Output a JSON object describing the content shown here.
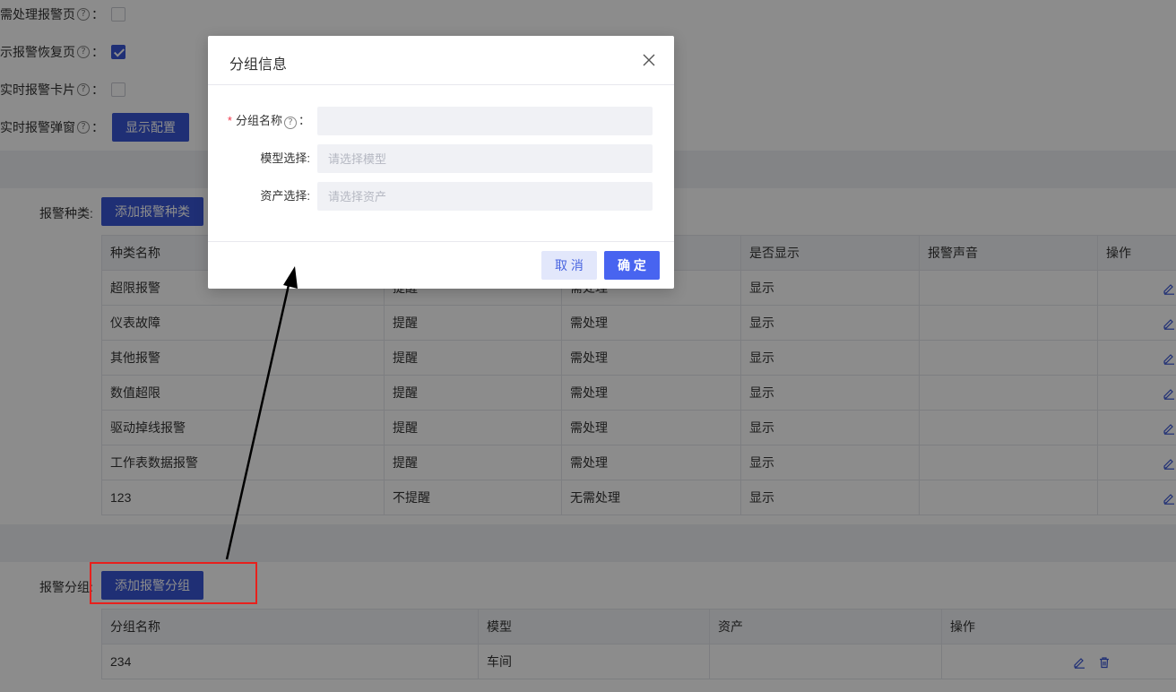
{
  "settings": [
    {
      "label": "需处理报警页",
      "checked": false
    },
    {
      "label": "示报警恢复页",
      "checked": true
    },
    {
      "label": "实时报警卡片",
      "checked": false
    },
    {
      "label": "实时报警弹窗",
      "button": "显示配置"
    }
  ],
  "help_glyph": "?",
  "colon": "：",
  "alarm_types": {
    "label": "报警种类:",
    "add_button": "添加报警种类",
    "columns": [
      "种类名称",
      "",
      "",
      "是否显示",
      "报警声音",
      "操作"
    ],
    "rows": [
      [
        "超限报警",
        "提醒",
        "需处理",
        "显示",
        ""
      ],
      [
        "仪表故障",
        "提醒",
        "需处理",
        "显示",
        ""
      ],
      [
        "其他报警",
        "提醒",
        "需处理",
        "显示",
        ""
      ],
      [
        "数值超限",
        "提醒",
        "需处理",
        "显示",
        ""
      ],
      [
        "驱动掉线报警",
        "提醒",
        "需处理",
        "显示",
        ""
      ],
      [
        "工作表数据报警",
        "提醒",
        "需处理",
        "显示",
        ""
      ],
      [
        "123",
        "不提醒",
        "无需处理",
        "显示",
        ""
      ]
    ]
  },
  "alarm_groups": {
    "label": "报警分组:",
    "add_button": "添加报警分组",
    "columns": [
      "分组名称",
      "模型",
      "资产",
      "操作"
    ],
    "rows": [
      [
        "234",
        "车间",
        ""
      ]
    ]
  },
  "modal": {
    "title": "分组信息",
    "fields": [
      {
        "label": "分组名称",
        "required": true,
        "help": true,
        "placeholder": "",
        "value": ""
      },
      {
        "label": "模型选择:",
        "required": false,
        "help": false,
        "placeholder": "请选择模型",
        "value": ""
      },
      {
        "label": "资产选择:",
        "required": false,
        "help": false,
        "placeholder": "请选择资产",
        "value": ""
      }
    ],
    "cancel_label": "取 消",
    "ok_label": "确 定"
  },
  "colors": {
    "primary": "#3a56d6",
    "ok_button": "#4864f0",
    "cancel_bg": "#e2e7fb",
    "annotation": "#e8201c",
    "required": "#f0364a"
  }
}
